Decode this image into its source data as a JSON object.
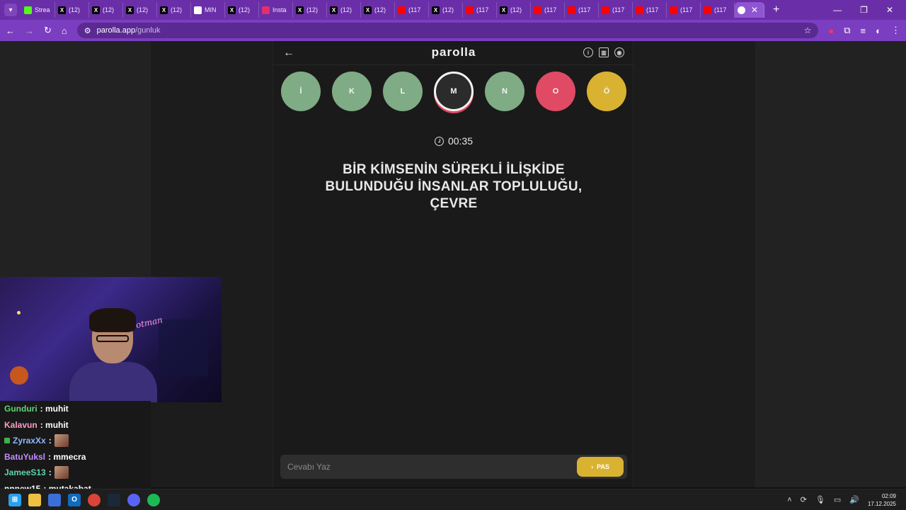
{
  "browser": {
    "tabs": [
      {
        "label": "Strea",
        "icon": "kick-icon",
        "color": "#53fc18"
      },
      {
        "label": "(12)",
        "icon": "x-icon",
        "color": "#000000"
      },
      {
        "label": "(12)",
        "icon": "x-icon",
        "color": "#000000"
      },
      {
        "label": "(12)",
        "icon": "x-icon",
        "color": "#000000"
      },
      {
        "label": "(12)",
        "icon": "x-icon",
        "color": "#000000"
      },
      {
        "label": "MIN",
        "icon": "mail-icon",
        "color": "#ffffff"
      },
      {
        "label": "(12)",
        "icon": "x-icon",
        "color": "#000000"
      },
      {
        "label": "Insta",
        "icon": "instagram-icon",
        "color": "#e1306c"
      },
      {
        "label": "(12)",
        "icon": "x-icon",
        "color": "#000000"
      },
      {
        "label": "(12)",
        "icon": "x-icon",
        "color": "#000000"
      },
      {
        "label": "(12)",
        "icon": "x-icon",
        "color": "#000000"
      },
      {
        "label": "(117",
        "icon": "youtube-icon",
        "color": "#ff0000"
      },
      {
        "label": "(12)",
        "icon": "x-icon",
        "color": "#000000"
      },
      {
        "label": "(117",
        "icon": "youtube-icon",
        "color": "#ff0000"
      },
      {
        "label": "(12)",
        "icon": "x-icon",
        "color": "#000000"
      },
      {
        "label": "(117",
        "icon": "youtube-icon",
        "color": "#ff0000"
      },
      {
        "label": "(117",
        "icon": "youtube-icon",
        "color": "#ff0000"
      },
      {
        "label": "(117",
        "icon": "youtube-icon",
        "color": "#ff0000"
      },
      {
        "label": "(117",
        "icon": "youtube-icon",
        "color": "#ff0000"
      },
      {
        "label": "(117",
        "icon": "youtube-icon",
        "color": "#ff0000"
      },
      {
        "label": "(117",
        "icon": "youtube-icon",
        "color": "#ff0000"
      }
    ],
    "url_host": "parolla.app",
    "url_path": "/gunluk"
  },
  "app": {
    "title": "parolla",
    "letters": [
      {
        "char": "İ",
        "state": "correct"
      },
      {
        "char": "K",
        "state": "correct"
      },
      {
        "char": "L",
        "state": "correct"
      },
      {
        "char": "M",
        "state": "current"
      },
      {
        "char": "N",
        "state": "correct"
      },
      {
        "char": "O",
        "state": "wrong"
      },
      {
        "char": "Ö",
        "state": "pass"
      }
    ],
    "timer": "00:35",
    "question": "BİR KİMSENİN SÜREKLİ İLİŞKİDE BULUNDUĞU İNSANLAR TOPLULUĞU, ÇEVRE",
    "answer_placeholder": "Cevabı Yaz",
    "pass_label": "PAS",
    "colors": {
      "correct": "#7fab85",
      "wrong": "#e04a64",
      "pass": "#d9b232",
      "current": "#2b2b2b"
    }
  },
  "webcam": {
    "neon_text": "hotman"
  },
  "chat": [
    {
      "user": "Gunduri",
      "msg": ": muhit",
      "color": "#5fd37a"
    },
    {
      "user": "Kalavun",
      "msg": ": muhit",
      "color": "#ff9ec7"
    },
    {
      "user": "ZyraxXx",
      "msg": ":",
      "color": "#8fb8ff",
      "badge": true,
      "emote": true
    },
    {
      "user": "BatuYuksl",
      "msg": ": mmecra",
      "color": "#c58cff"
    },
    {
      "user": "JameeS13",
      "msg": ":",
      "color": "#5fd3b0",
      "emote": true
    },
    {
      "user": "nnnew15",
      "msg": ": mutakabat",
      "color": "#ffffff"
    }
  ],
  "taskbar": {
    "time": "02:09",
    "date": "17.12.2025"
  }
}
